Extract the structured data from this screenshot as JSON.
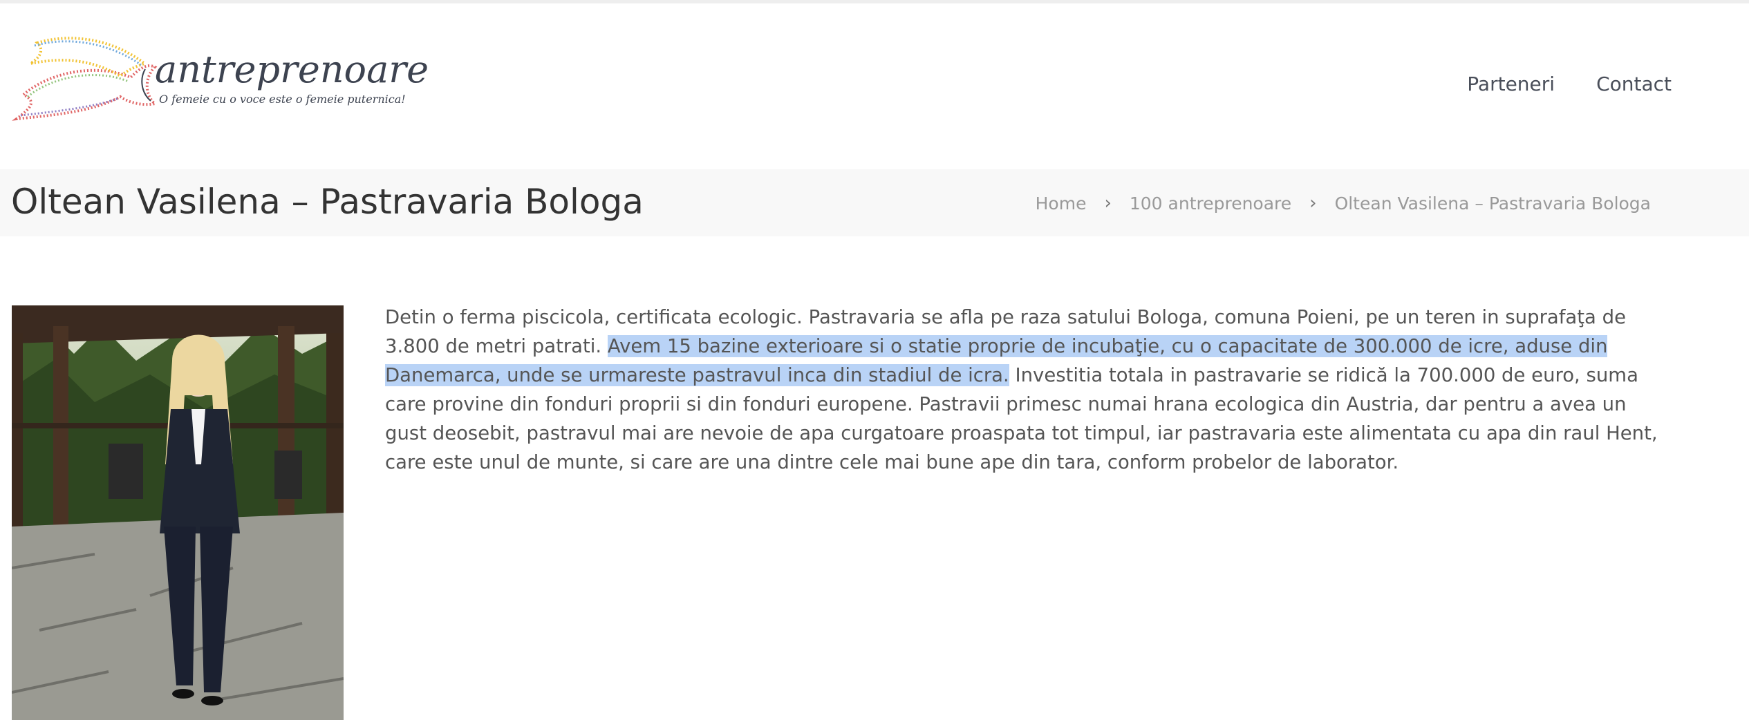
{
  "site": {
    "logo_word": "antreprenoare",
    "logo_tagline": "O femeie cu o voce este o femeie puternica!"
  },
  "nav": {
    "items": [
      {
        "label": "Parteneri"
      },
      {
        "label": "Contact"
      }
    ]
  },
  "page": {
    "title": "Oltean Vasilena – Pastravaria Bologa"
  },
  "breadcrumb": {
    "items": [
      {
        "label": "Home"
      },
      {
        "label": "100 antreprenoare"
      },
      {
        "label": "Oltean Vasilena – Pastravaria Bologa"
      }
    ],
    "separator": "›"
  },
  "content": {
    "part1": "Detin o ferma piscicola, certificata ecologic. Pastravaria se afla pe raza satului Bologa, comuna Poieni, pe un teren in suprafaţa de 3.800 de metri patrati. ",
    "part2_selected": "Avem 15 bazine exterioare si o statie proprie de incubaţie, cu o capacitate de 300.000 de icre, aduse din Danemarca, unde se urmareste pastravul inca din stadiul de icra.",
    "part3": " Investitia totala in pastravarie se ridică la 700.000 de euro, suma care provine din fonduri proprii si din fonduri europene. Pastravii primesc numai hrana ecologica  din Austria, dar pentru a avea un gust deosebit, pastravul mai are nevoie de apa curgatoare proaspata tot timpul, iar pastravaria este alimentata cu apa din raul Hent, care este unul de munte, si care are una dintre cele mai bune ape din tara, conform probelor de laborator."
  },
  "colors": {
    "selection": "#b9d3f6",
    "titlebar_bg": "#f8f8f8",
    "text": "#555555"
  }
}
